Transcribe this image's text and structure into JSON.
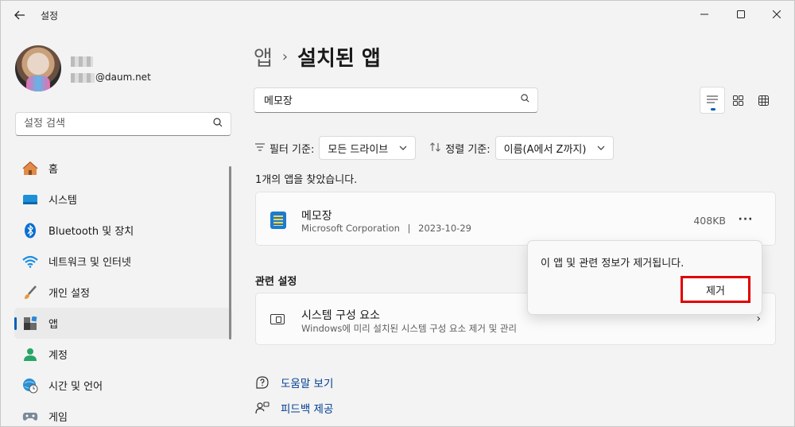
{
  "window": {
    "title": "설정",
    "back_icon": "back-arrow-icon",
    "controls": {
      "minimize": "─",
      "maximize": "☐",
      "close": "✕"
    }
  },
  "profile": {
    "email_suffix": "@daum.net"
  },
  "sidebar": {
    "search_placeholder": "설정 검색",
    "items": [
      {
        "label": "홈",
        "icon": "home-icon",
        "active": false
      },
      {
        "label": "시스템",
        "icon": "system-icon",
        "active": false
      },
      {
        "label": "Bluetooth 및 장치",
        "icon": "bluetooth-icon",
        "active": false
      },
      {
        "label": "네트워크 및 인터넷",
        "icon": "wifi-icon",
        "active": false
      },
      {
        "label": "개인 설정",
        "icon": "brush-icon",
        "active": false
      },
      {
        "label": "앱",
        "icon": "apps-icon",
        "active": true
      },
      {
        "label": "계정",
        "icon": "account-icon",
        "active": false
      },
      {
        "label": "시간 및 언어",
        "icon": "time-language-icon",
        "active": false
      },
      {
        "label": "게임",
        "icon": "gaming-icon",
        "active": false
      }
    ]
  },
  "breadcrumb": {
    "parent": "앱",
    "separator": "›",
    "current": "설치된 앱"
  },
  "search": {
    "value": "메모장"
  },
  "filter": {
    "label": "필터 기준:",
    "value": "모든 드라이브",
    "sort_label": "정렬 기준:",
    "sort_value": "이름(A에서 Z까지)"
  },
  "results": {
    "count_text": "1개의 앱을 찾았습니다."
  },
  "app": {
    "name": "메모장",
    "publisher": "Microsoft Corporation",
    "separator": "|",
    "date": "2023-10-29",
    "size": "408KB",
    "more": "···"
  },
  "related": {
    "section_title": "관련 설정",
    "item_title": "시스템 구성 요소",
    "item_desc": "Windows에 미리 설치된 시스템 구성 요소 제거 및 관리",
    "chevron": "›"
  },
  "links": {
    "help": "도움말 보기",
    "feedback": "피드백 제공"
  },
  "flyout": {
    "message": "이 앱 및 관련 정보가 제거됩니다.",
    "button": "제거"
  },
  "colors": {
    "accent": "#005fb8",
    "highlight": "#e00000",
    "background": "#f3f3f3"
  }
}
